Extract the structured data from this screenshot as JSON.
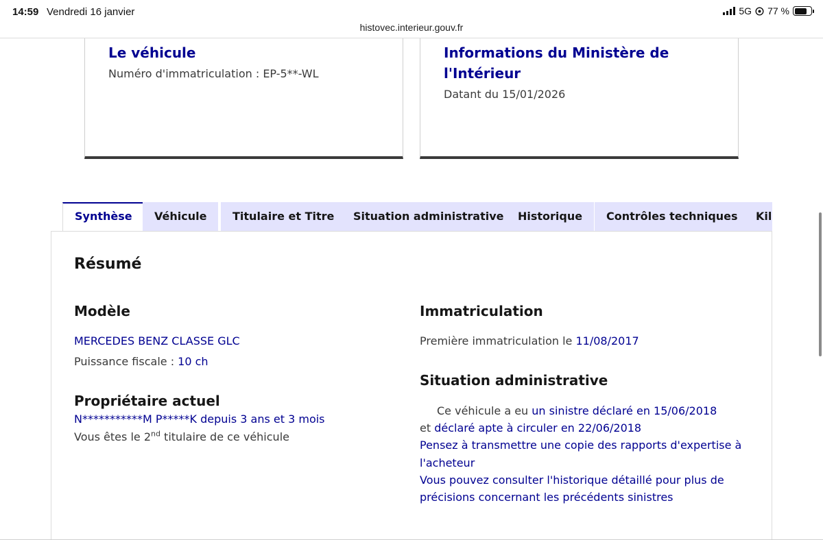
{
  "status_bar": {
    "time": "14:59",
    "date": "Vendredi 16 janvier",
    "network": "5G",
    "battery": "77 %",
    "battery_level": 0.77
  },
  "browser": {
    "url": "histovec.interieur.gouv.fr"
  },
  "card_vehicle": {
    "title": "Le véhicule",
    "plate_label": "Numéro d'immatriculation : EP-5**-WL"
  },
  "card_ministry": {
    "title": "Informations du Ministère de l'Intérieur",
    "date_label": "Datant du 15/01/2026"
  },
  "tabs": [
    {
      "label": "Synthèse",
      "active": true
    },
    {
      "label": "Véhicule",
      "active": false
    },
    {
      "label": "Titulaire et Titre",
      "active": false
    },
    {
      "label": "Situation administrative",
      "active": false
    },
    {
      "label": "Historique",
      "active": false
    },
    {
      "label": "Contrôles techniques",
      "active": false
    },
    {
      "label": "Kilométrage",
      "active": false
    }
  ],
  "summary": {
    "title": "Résumé",
    "model": {
      "heading": "Modèle",
      "name": "MERCEDES BENZ CLASSE GLC",
      "power_label": "Puissance fiscale : ",
      "power_value": "10 ch"
    },
    "owner": {
      "heading": "Propriétaire actuel",
      "name": "N***********M P*****K",
      "since_label": " depuis ",
      "since_value": "3 ans et 3 mois",
      "rank_prefix": "Vous êtes le 2",
      "rank_sup": "nd",
      "rank_suffix": " titulaire de ce véhicule"
    },
    "registration": {
      "heading": "Immatriculation",
      "first_label": "Première immatriculation le ",
      "first_date": "11/08/2017"
    },
    "admin": {
      "heading": "Situation administrative",
      "line1_prefix": "Ce véhicule a eu ",
      "line1_link": "un sinistre déclaré en 15/06/2018",
      "line2_prefix": "et ",
      "line2_link": "déclaré apte à circuler en 22/06/2018",
      "line3": "Pensez à transmettre une copie des rapports d'expertise à",
      "line4": "l'acheteur",
      "line5": "Vous pouvez consulter l'historique détaillé pour plus de",
      "line6": "précisions concernant les précédents sinistres"
    }
  }
}
